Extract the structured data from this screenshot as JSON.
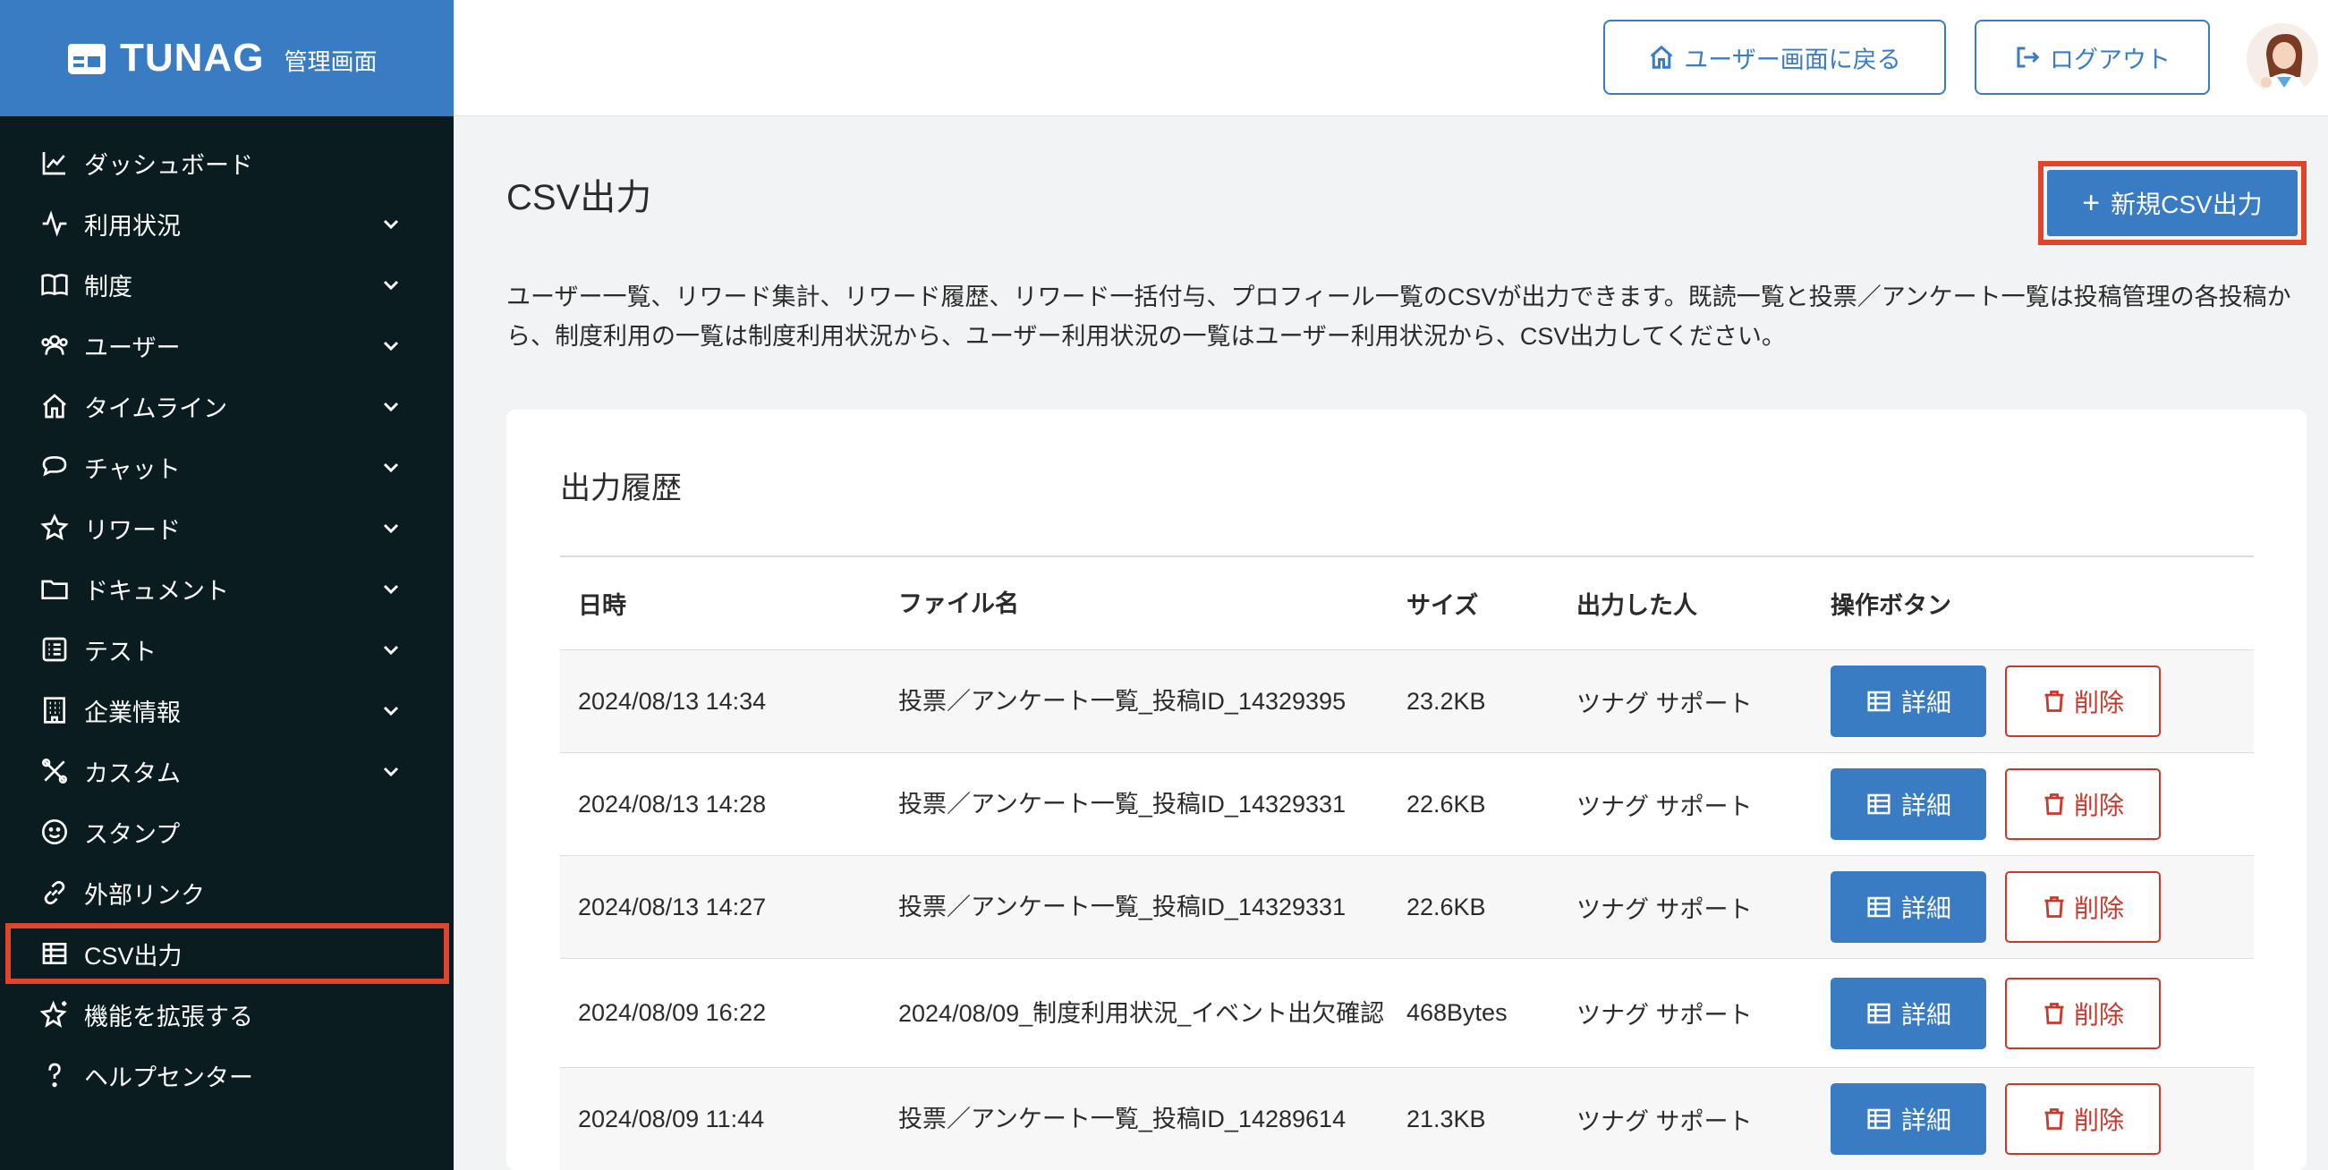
{
  "brand": {
    "name": "TUNAG",
    "subtitle": "管理画面"
  },
  "sidebar": {
    "items": [
      {
        "label": "ダッシュボード",
        "icon": "chart-line-icon",
        "expandable": false
      },
      {
        "label": "利用状況",
        "icon": "activity-icon",
        "expandable": true
      },
      {
        "label": "制度",
        "icon": "book-icon",
        "expandable": true
      },
      {
        "label": "ユーザー",
        "icon": "users-icon",
        "expandable": true
      },
      {
        "label": "タイムライン",
        "icon": "home-icon",
        "expandable": true
      },
      {
        "label": "チャット",
        "icon": "chat-bubble-icon",
        "expandable": true
      },
      {
        "label": "リワード",
        "icon": "star-icon",
        "expandable": true
      },
      {
        "label": "ドキュメント",
        "icon": "folder-icon",
        "expandable": true
      },
      {
        "label": "テスト",
        "icon": "checklist-icon",
        "expandable": true
      },
      {
        "label": "企業情報",
        "icon": "building-icon",
        "expandable": true
      },
      {
        "label": "カスタム",
        "icon": "tools-icon",
        "expandable": true
      },
      {
        "label": "スタンプ",
        "icon": "smiley-icon",
        "expandable": false
      },
      {
        "label": "外部リンク",
        "icon": "link-icon",
        "expandable": false
      },
      {
        "label": "CSV出力",
        "icon": "table-icon",
        "expandable": false,
        "active": true
      },
      {
        "label": "機能を拡張する",
        "icon": "sparkle-star-icon",
        "expandable": false
      },
      {
        "label": "ヘルプセンター",
        "icon": "help-icon",
        "expandable": false
      }
    ]
  },
  "topbar": {
    "back_label": "ユーザー画面に戻る",
    "logout_label": "ログアウト"
  },
  "main": {
    "title": "CSV出力",
    "new_button_label": "新規CSV出力",
    "description": "ユーザー一覧、リワード集計、リワード履歴、リワード一括付与、プロフィール一覧のCSVが出力できます。既読一覧と投票／アンケート一覧は投稿管理の各投稿から、制度利用の一覧は制度利用状況から、ユーザー利用状況の一覧はユーザー利用状況から、CSV出力してください。",
    "history": {
      "title": "出力履歴",
      "columns": [
        "日時",
        "ファイル名",
        "サイズ",
        "出力した人",
        "操作ボタン"
      ],
      "detail_label": "詳細",
      "delete_label": "削除",
      "rows": [
        {
          "datetime": "2024/08/13 14:34",
          "filename": "投票／アンケート一覧_投稿ID_14329395",
          "size": "23.2KB",
          "user": "ツナグ サポート"
        },
        {
          "datetime": "2024/08/13 14:28",
          "filename": "投票／アンケート一覧_投稿ID_14329331",
          "size": "22.6KB",
          "user": "ツナグ サポート"
        },
        {
          "datetime": "2024/08/13 14:27",
          "filename": "投票／アンケート一覧_投稿ID_14329331",
          "size": "22.6KB",
          "user": "ツナグ サポート"
        },
        {
          "datetime": "2024/08/09 16:22",
          "filename": "2024/08/09_制度利用状況_イベント出欠確認",
          "size": "468Bytes",
          "user": "ツナグ サポート"
        },
        {
          "datetime": "2024/08/09 11:44",
          "filename": "投票／アンケート一覧_投稿ID_14289614",
          "size": "21.3KB",
          "user": "ツナグ サポート"
        }
      ]
    }
  },
  "colors": {
    "brand": "#3a7cc4",
    "sidebar_bg": "#0a1c1f",
    "highlight": "#e0452c",
    "danger": "#c8392b"
  }
}
